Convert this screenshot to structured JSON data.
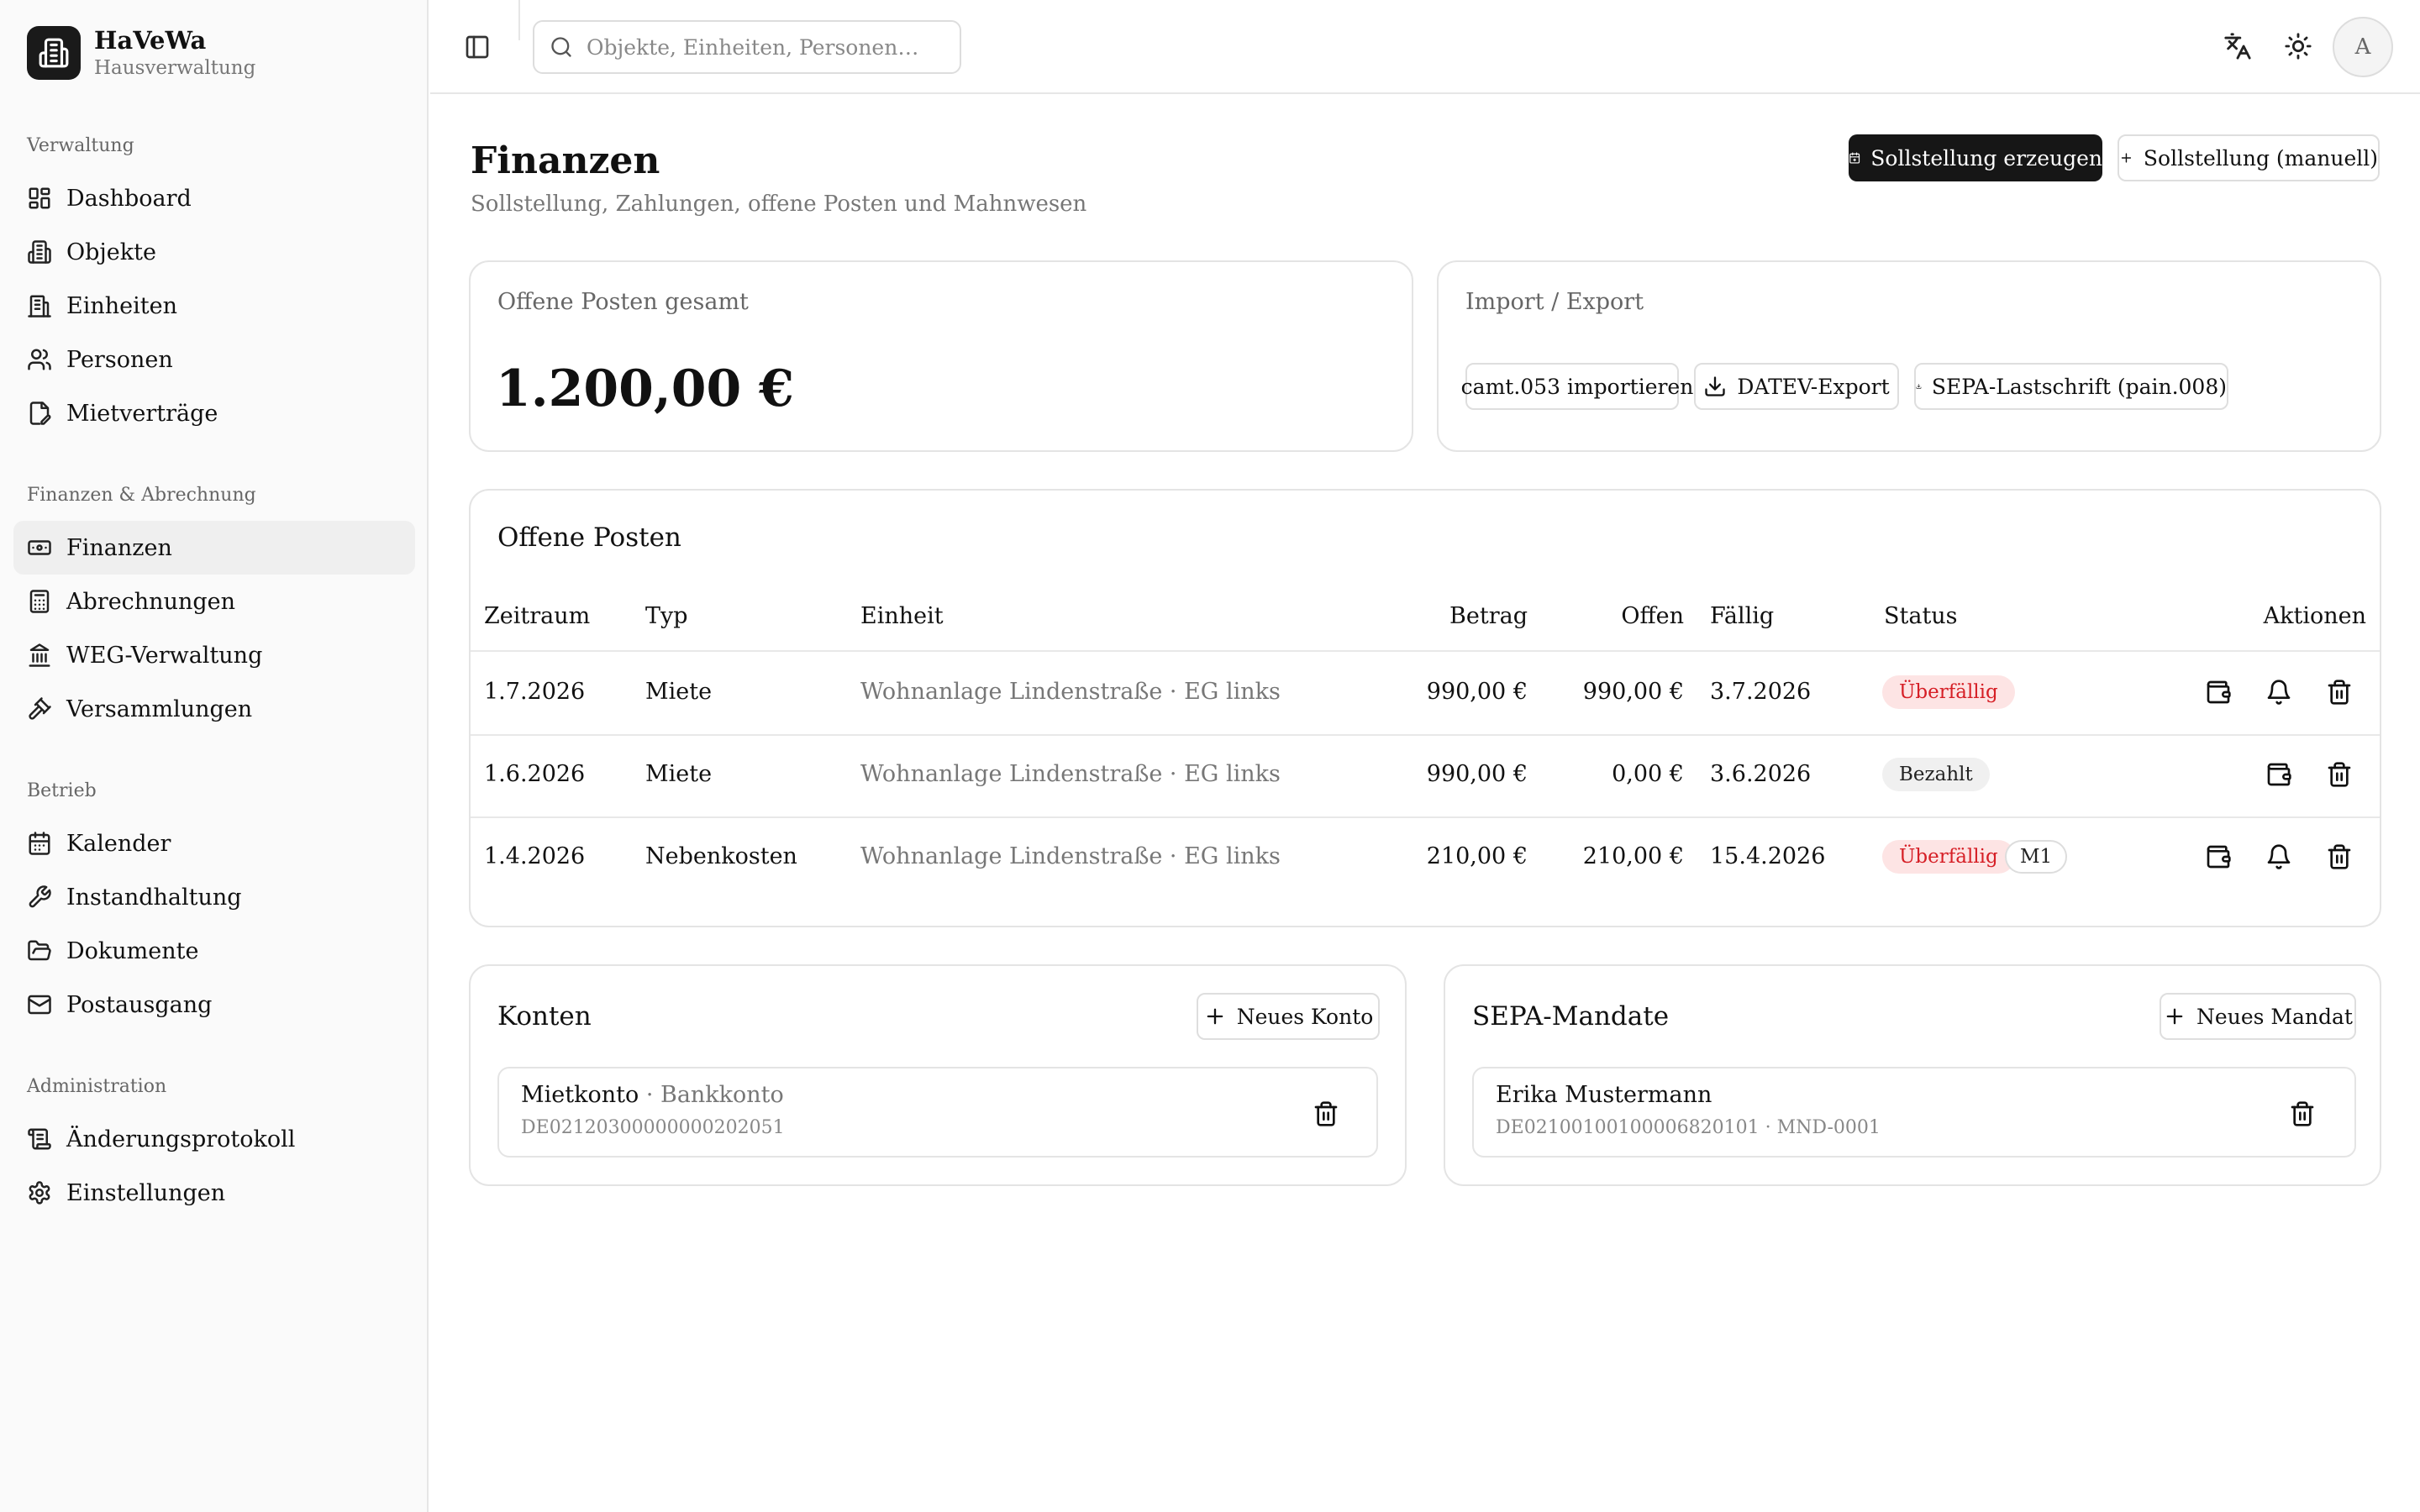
{
  "brand": {
    "name": "HaVeWa",
    "subtitle": "Hausverwaltung"
  },
  "nav": {
    "groups": [
      {
        "title": "Verwaltung",
        "items": [
          {
            "label": "Dashboard",
            "icon": "dashboard-icon"
          },
          {
            "label": "Objekte",
            "icon": "building-icon"
          },
          {
            "label": "Einheiten",
            "icon": "building-2-icon"
          },
          {
            "label": "Personen",
            "icon": "users-icon"
          },
          {
            "label": "Mietverträge",
            "icon": "file-signature-icon"
          }
        ]
      },
      {
        "title": "Finanzen & Abrechnung",
        "items": [
          {
            "label": "Finanzen",
            "icon": "banknote-icon",
            "active": true
          },
          {
            "label": "Abrechnungen",
            "icon": "calculator-icon"
          },
          {
            "label": "WEG-Verwaltung",
            "icon": "landmark-icon"
          },
          {
            "label": "Versammlungen",
            "icon": "gavel-icon"
          }
        ]
      },
      {
        "title": "Betrieb",
        "items": [
          {
            "label": "Kalender",
            "icon": "calendar-icon"
          },
          {
            "label": "Instandhaltung",
            "icon": "wrench-icon"
          },
          {
            "label": "Dokumente",
            "icon": "folder-icon"
          },
          {
            "label": "Postausgang",
            "icon": "mail-icon"
          }
        ]
      },
      {
        "title": "Administration",
        "items": [
          {
            "label": "Änderungsprotokoll",
            "icon": "scroll-icon"
          },
          {
            "label": "Einstellungen",
            "icon": "gear-icon"
          }
        ]
      }
    ]
  },
  "topbar": {
    "search_placeholder": "Objekte, Einheiten, Personen…",
    "avatar_initial": "A"
  },
  "page": {
    "title": "Finanzen",
    "subtitle": "Sollstellung, Zahlungen, offene Posten und Mahnwesen",
    "btn_generate": "Sollstellung erzeugen",
    "btn_manual": "Sollstellung (manuell)"
  },
  "summary": {
    "label": "Offene Posten gesamt",
    "value": "1.200,00 €"
  },
  "import_export": {
    "title": "Import / Export",
    "btn_camt": "camt.053 importieren",
    "btn_datev": "DATEV-Export",
    "btn_sepa": "SEPA-Lastschrift (pain.008)"
  },
  "open_items": {
    "title": "Offene Posten",
    "headers": {
      "period": "Zeitraum",
      "type": "Typ",
      "unit": "Einheit",
      "amount": "Betrag",
      "open": "Offen",
      "due": "Fällig",
      "status": "Status",
      "actions": "Aktionen"
    },
    "rows": [
      {
        "period": "1.7.2026",
        "type": "Miete",
        "unit": "Wohnanlage Lindenstraße · EG links",
        "amount": "990,00 €",
        "open": "990,00 €",
        "due": "3.7.2026",
        "status": "Überfällig",
        "status_kind": "overdue",
        "dunning": ""
      },
      {
        "period": "1.6.2026",
        "type": "Miete",
        "unit": "Wohnanlage Lindenstraße · EG links",
        "amount": "990,00 €",
        "open": "0,00 €",
        "due": "3.6.2026",
        "status": "Bezahlt",
        "status_kind": "paid",
        "dunning": ""
      },
      {
        "period": "1.4.2026",
        "type": "Nebenkosten",
        "unit": "Wohnanlage Lindenstraße · EG links",
        "amount": "210,00 €",
        "open": "210,00 €",
        "due": "15.4.2026",
        "status": "Überfällig",
        "status_kind": "overdue",
        "dunning": "M1"
      }
    ]
  },
  "accounts": {
    "title": "Konten",
    "btn_new": "Neues Konto",
    "items": [
      {
        "name": "Mietkonto",
        "kind": "Bankkonto",
        "iban": "DE02120300000000202051"
      }
    ]
  },
  "mandates": {
    "title": "SEPA-Mandate",
    "btn_new": "Neues Mandat",
    "items": [
      {
        "name": "Erika Mustermann",
        "details": "DE02100100100006820101 · MND-0001"
      }
    ]
  },
  "colors": {
    "accent_dark": "#161616",
    "overdue_bg": "#fde4e4",
    "overdue_text": "#d61f26",
    "paid_bg": "#f0f0f0"
  }
}
